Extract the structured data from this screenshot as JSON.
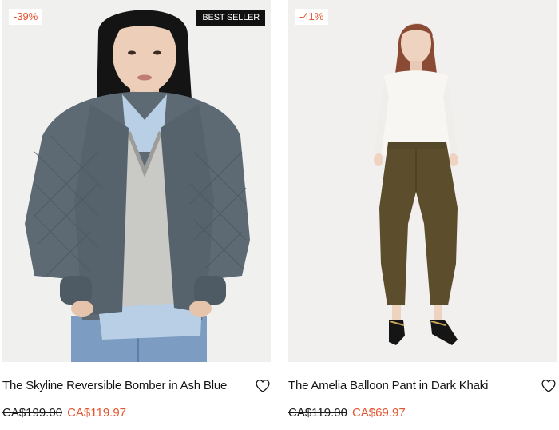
{
  "products": [
    {
      "discount": "-39%",
      "badge": "BEST SELLER",
      "title": "The Skyline Reversible Bomber in Ash Blue",
      "old_price": "CA$199.00",
      "new_price": "CA$119.97",
      "image": "woman-in-ash-blue-quilted-bomber-jacket"
    },
    {
      "discount": "-41%",
      "title": "The Amelia Balloon Pant in Dark Khaki",
      "old_price": "CA$119.00",
      "new_price": "CA$69.97",
      "image": "woman-in-dark-khaki-balloon-pants"
    }
  ],
  "icons": {
    "wishlist": "heart-outline-icon"
  },
  "colors": {
    "sale": "#e3552f",
    "text": "#151515",
    "badge_bg": "#111111",
    "image_bg": "#f0f0ee"
  }
}
